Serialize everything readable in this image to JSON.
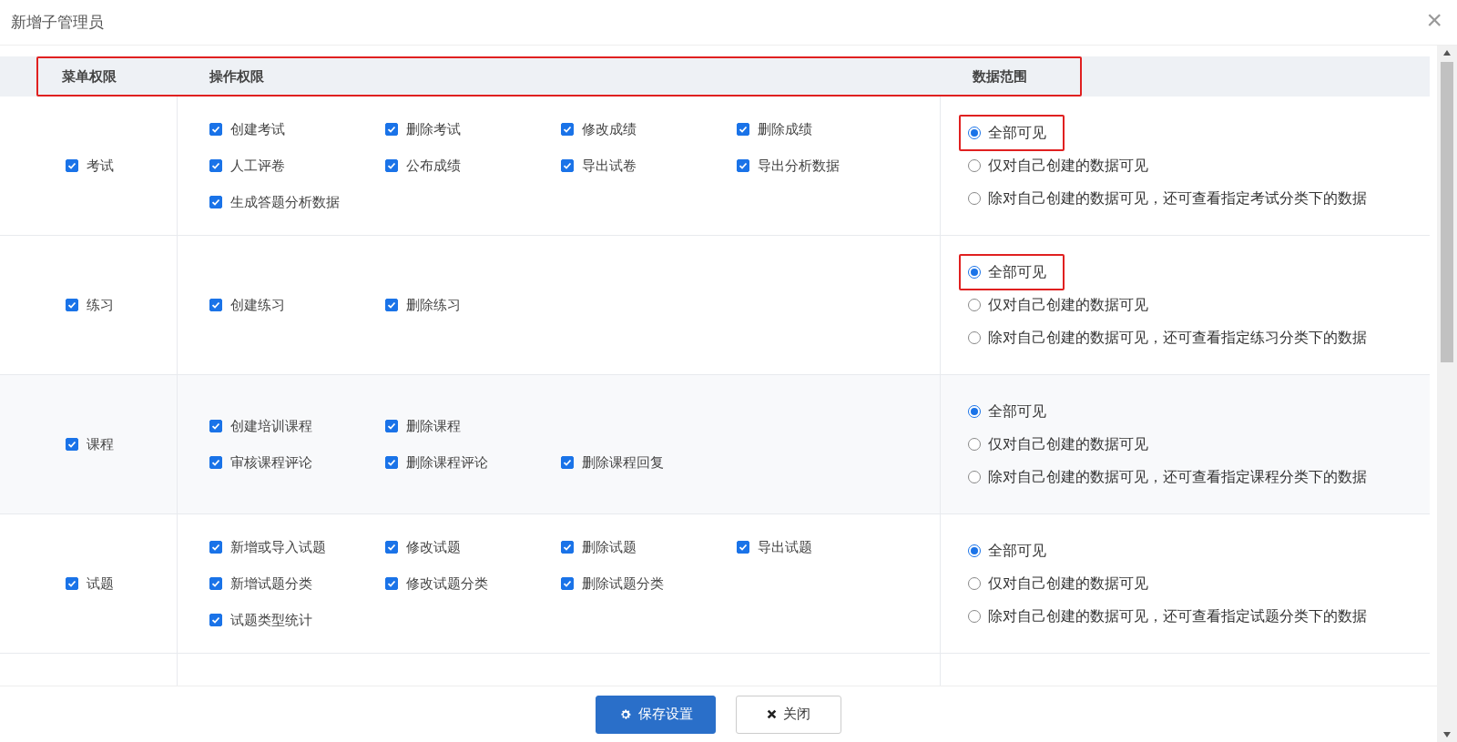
{
  "dialog": {
    "title": "新增子管理员",
    "close": "×"
  },
  "table": {
    "highlighted": true,
    "columns": [
      "菜单权限",
      "操作权限",
      "数据范围"
    ],
    "rows": [
      {
        "menu": {
          "label": "考试",
          "checked": true
        },
        "operation_lines": [
          [
            {
              "label": "创建考试",
              "checked": true
            },
            {
              "label": "删除考试",
              "checked": true
            },
            {
              "label": "修改成绩",
              "checked": true
            },
            {
              "label": "删除成绩",
              "checked": true
            }
          ],
          [
            {
              "label": "人工评卷",
              "checked": true
            },
            {
              "label": "公布成绩",
              "checked": true
            },
            {
              "label": "导出试卷",
              "checked": true
            },
            {
              "label": "导出分析数据",
              "checked": true
            }
          ],
          [
            {
              "label": "生成答题分析数据",
              "checked": true
            }
          ]
        ],
        "scope": [
          {
            "label": "全部可见",
            "selected": true,
            "highlighted": true
          },
          {
            "label": "仅对自己创建的数据可见",
            "selected": false,
            "highlighted": false
          },
          {
            "label": "除对自己创建的数据可见，还可查看指定考试分类下的数据",
            "selected": false,
            "highlighted": false
          }
        ]
      },
      {
        "menu": {
          "label": "练习",
          "checked": true
        },
        "operation_lines": [
          [
            {
              "label": "创建练习",
              "checked": true
            },
            {
              "label": "删除练习",
              "checked": true
            }
          ]
        ],
        "scope": [
          {
            "label": "全部可见",
            "selected": true,
            "highlighted": true
          },
          {
            "label": "仅对自己创建的数据可见",
            "selected": false,
            "highlighted": false
          },
          {
            "label": "除对自己创建的数据可见，还可查看指定练习分类下的数据",
            "selected": false,
            "highlighted": false
          }
        ]
      },
      {
        "menu": {
          "label": "课程",
          "checked": true
        },
        "operation_lines": [
          [
            {
              "label": "创建培训课程",
              "checked": true
            },
            {
              "label": "删除课程",
              "checked": true
            }
          ],
          [
            {
              "label": "审核课程评论",
              "checked": true
            },
            {
              "label": "删除课程评论",
              "checked": true
            },
            {
              "label": "删除课程回复",
              "checked": true
            }
          ]
        ],
        "scope": [
          {
            "label": "全部可见",
            "selected": true,
            "highlighted": false
          },
          {
            "label": "仅对自己创建的数据可见",
            "selected": false,
            "highlighted": false
          },
          {
            "label": "除对自己创建的数据可见，还可查看指定课程分类下的数据",
            "selected": false,
            "highlighted": false
          }
        ]
      },
      {
        "menu": {
          "label": "试题",
          "checked": true
        },
        "operation_lines": [
          [
            {
              "label": "新增或导入试题",
              "checked": true
            },
            {
              "label": "修改试题",
              "checked": true
            },
            {
              "label": "删除试题",
              "checked": true
            },
            {
              "label": "导出试题",
              "checked": true
            }
          ],
          [
            {
              "label": "新增试题分类",
              "checked": true
            },
            {
              "label": "修改试题分类",
              "checked": true
            },
            {
              "label": "删除试题分类",
              "checked": true
            }
          ],
          [
            {
              "label": "试题类型统计",
              "checked": true
            }
          ]
        ],
        "scope": [
          {
            "label": "全部可见",
            "selected": true,
            "highlighted": false
          },
          {
            "label": "仅对自己创建的数据可见",
            "selected": false,
            "highlighted": false
          },
          {
            "label": "除对自己创建的数据可见，还可查看指定试题分类下的数据",
            "selected": false,
            "highlighted": false
          }
        ]
      }
    ]
  },
  "footer": {
    "buttons": [
      {
        "kind": "primary",
        "label": "保存设置"
      },
      {
        "kind": "secondary",
        "label": "关闭"
      }
    ]
  }
}
